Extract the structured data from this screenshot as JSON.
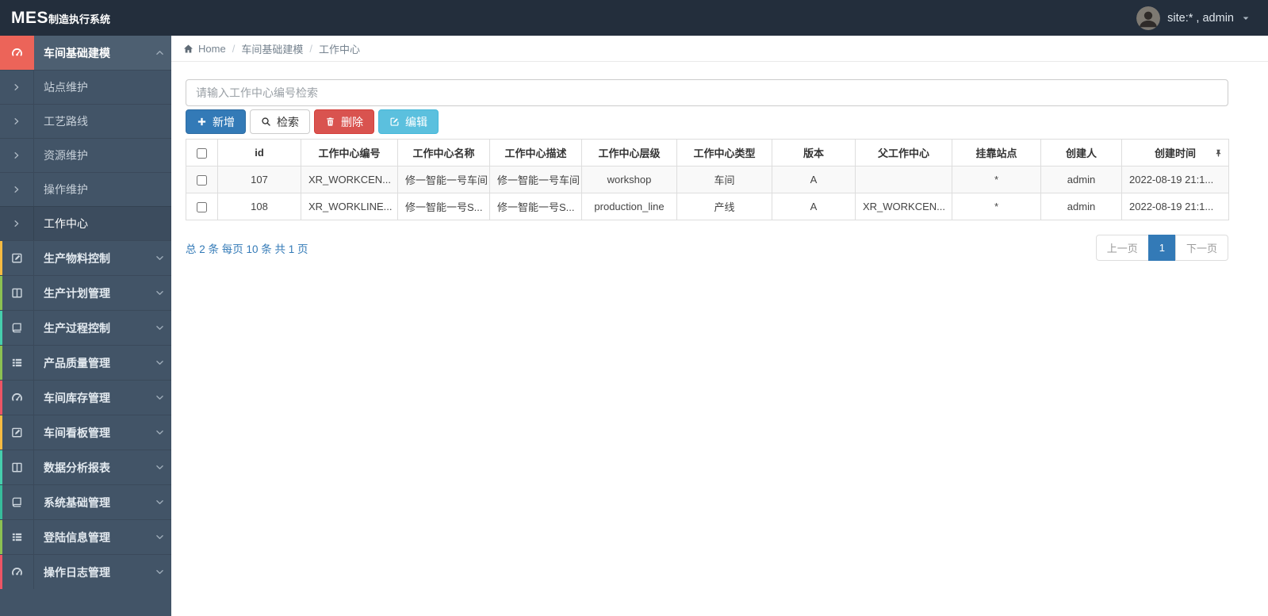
{
  "navbar": {
    "brand_bold": "MES",
    "brand_rest": "制造执行系统",
    "user_label": "site:* , admin"
  },
  "breadcrumb": {
    "home": "Home",
    "items": [
      "车间基础建模",
      "工作中心"
    ]
  },
  "sidebar": {
    "items": [
      {
        "label": "车间基础建模",
        "icon": "dashboard-icon",
        "accent": "#ec6459",
        "expanded": true,
        "children": [
          {
            "label": "站点维护",
            "active": false
          },
          {
            "label": "工艺路线",
            "active": false
          },
          {
            "label": "资源维护",
            "active": false
          },
          {
            "label": "操作维护",
            "active": false
          },
          {
            "label": "工作中心",
            "active": true
          }
        ]
      },
      {
        "label": "生产物料控制",
        "icon": "edit-square-icon",
        "accent": "#f6bb42"
      },
      {
        "label": "生产计划管理",
        "icon": "columns-icon",
        "accent": "#8cc152"
      },
      {
        "label": "生产过程控制",
        "icon": "book-icon",
        "accent": "#46cead"
      },
      {
        "label": "产品质量管理",
        "icon": "list-icon",
        "accent": "#8cc152"
      },
      {
        "label": "车间库存管理",
        "icon": "dashboard-icon",
        "accent": "#ed5565"
      },
      {
        "label": "车间看板管理",
        "icon": "edit-square-icon",
        "accent": "#f6bb42"
      },
      {
        "label": "数据分析报表",
        "icon": "columns-icon",
        "accent": "#46cead"
      },
      {
        "label": "系统基础管理",
        "icon": "book-icon",
        "accent": "#37bc9b"
      },
      {
        "label": "登陆信息管理",
        "icon": "list-icon",
        "accent": "#8cc152"
      },
      {
        "label": "操作日志管理",
        "icon": "dashboard-icon",
        "accent": "#ed5565"
      }
    ]
  },
  "search": {
    "placeholder": "请输入工作中心编号检索",
    "value": ""
  },
  "toolbar": {
    "buttons": [
      {
        "label": "新增",
        "icon": "plus-icon",
        "style": "primary"
      },
      {
        "label": "检索",
        "icon": "search-icon",
        "style": "default"
      },
      {
        "label": "删除",
        "icon": "trash-icon",
        "style": "danger"
      },
      {
        "label": "编辑",
        "icon": "edit-icon",
        "style": "info"
      }
    ]
  },
  "table": {
    "columns": [
      "id",
      "工作中心编号",
      "工作中心名称",
      "工作中心描述",
      "工作中心层级",
      "工作中心类型",
      "版本",
      "父工作中心",
      "挂靠站点",
      "创建人",
      "创建时间"
    ],
    "rows": [
      [
        "107",
        "XR_WORKCEN...",
        "修一智能一号车间",
        "修一智能一号车间",
        "workshop",
        "车间",
        "A",
        "",
        "*",
        "admin",
        "2022-08-19 21:1..."
      ],
      [
        "108",
        "XR_WORKLINE...",
        "修一智能一号S...",
        "修一智能一号S...",
        "production_line",
        "产线",
        "A",
        "XR_WORKCEN...",
        "*",
        "admin",
        "2022-08-19 21:1..."
      ]
    ]
  },
  "pagination": {
    "summary": "总 2 条 每页 10 条 共 1 页",
    "prev": "上一页",
    "current": "1",
    "next": "下一页"
  },
  "colors": {
    "navbar_bg": "#232e3c",
    "sidebar_bg": "#425467",
    "active_icon_bg": "#ec6459",
    "primary": "#337ab7",
    "danger": "#d9534f",
    "info": "#5bc0de"
  }
}
